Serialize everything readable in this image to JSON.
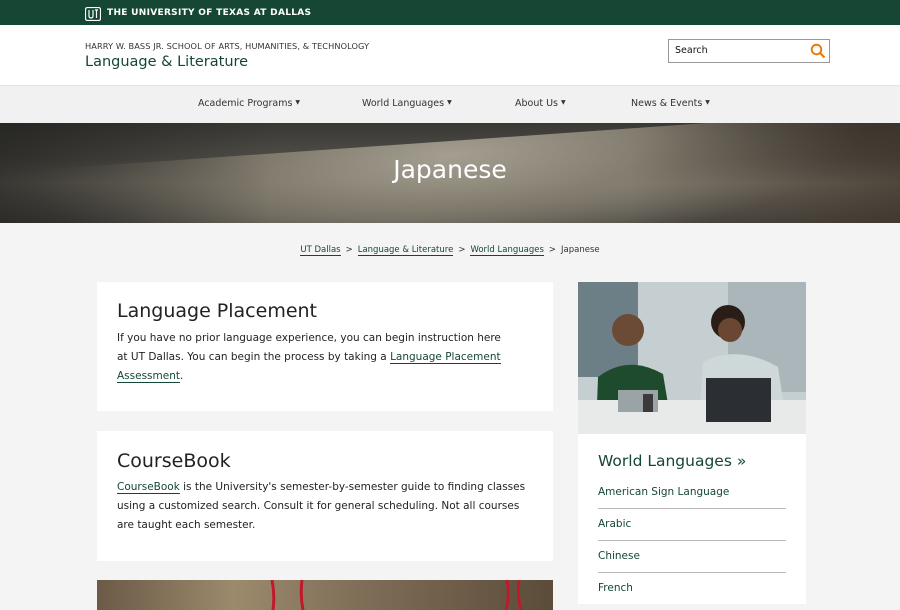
{
  "topbar": {
    "university": "THE UNIVERSITY OF TEXAS AT DALLAS",
    "brand_color": "#154734"
  },
  "header": {
    "school": "HARRY W. BASS JR. SCHOOL OF ARTS, HUMANITIES, & TECHNOLOGY",
    "department": "Language & Literature"
  },
  "search": {
    "placeholder": "Search",
    "icon": "search-icon",
    "icon_color": "#e87500"
  },
  "nav": {
    "items": [
      "Academic Programs",
      "World Languages",
      "About Us",
      "News & Events"
    ]
  },
  "hero": {
    "title": "Japanese"
  },
  "breadcrumb": {
    "links": [
      "UT Dallas",
      "Language & Literature",
      "World Languages"
    ],
    "current": "Japanese",
    "separator": ">"
  },
  "placement": {
    "title": "Language Placement",
    "text": "If you have no prior language experience, you can begin instruction here at UT Dallas. You can begin the process by taking a",
    "link": "Language Placement Assessment",
    "suffix": "."
  },
  "coursebook": {
    "title": "CourseBook",
    "link": "CourseBook",
    "text": "is the University's semester-by-semester guide to finding classes using a customized search. Consult it for general scheduling. Not all courses are taught each semester."
  },
  "sidebar": {
    "heading": "World Languages »",
    "languages": [
      "American Sign Language",
      "Arabic",
      "Chinese",
      "French"
    ]
  }
}
